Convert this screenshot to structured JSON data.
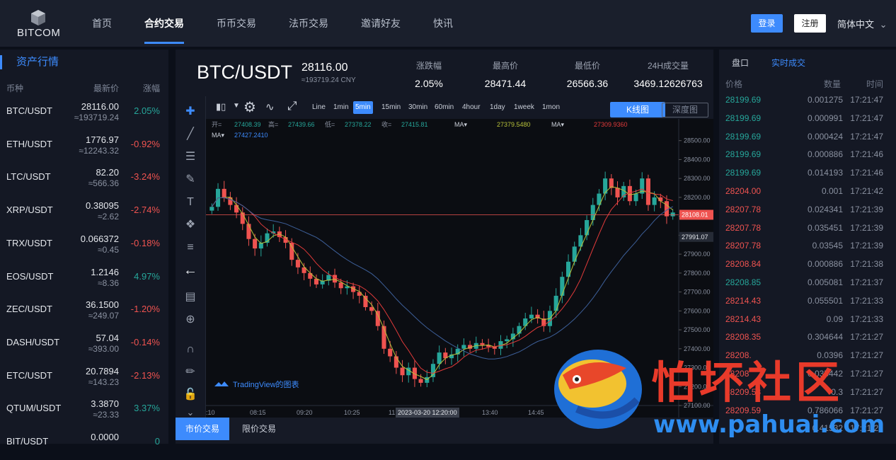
{
  "brand": {
    "name": "BITCOM"
  },
  "nav": {
    "items": [
      "首页",
      "合约交易",
      "币币交易",
      "法币交易",
      "邀请好友",
      "快讯"
    ],
    "active": 1
  },
  "auth": {
    "login": "登录",
    "register": "注册",
    "language": "简体中文"
  },
  "market": {
    "title": "资产行情",
    "headers": {
      "symbol": "币种",
      "price": "最新价",
      "change": "涨幅"
    },
    "rows": [
      {
        "symbol": "BTC/USDT",
        "price": "28116.00",
        "cny": "≈193719.24",
        "change": "2.05%",
        "dir": "up"
      },
      {
        "symbol": "ETH/USDT",
        "price": "1776.97",
        "cny": "≈12243.32",
        "change": "-0.92%",
        "dir": "dn"
      },
      {
        "symbol": "LTC/USDT",
        "price": "82.20",
        "cny": "≈566.36",
        "change": "-3.24%",
        "dir": "dn"
      },
      {
        "symbol": "XRP/USDT",
        "price": "0.38095",
        "cny": "≈2.62",
        "change": "-2.74%",
        "dir": "dn"
      },
      {
        "symbol": "TRX/USDT",
        "price": "0.066372",
        "cny": "≈0.45",
        "change": "-0.18%",
        "dir": "dn"
      },
      {
        "symbol": "EOS/USDT",
        "price": "1.2146",
        "cny": "≈8.36",
        "change": "4.97%",
        "dir": "up"
      },
      {
        "symbol": "ZEC/USDT",
        "price": "36.1500",
        "cny": "≈249.07",
        "change": "-1.20%",
        "dir": "dn"
      },
      {
        "symbol": "DASH/USDT",
        "price": "57.04",
        "cny": "≈393.00",
        "change": "-0.14%",
        "dir": "dn"
      },
      {
        "symbol": "ETC/USDT",
        "price": "20.7894",
        "cny": "≈143.23",
        "change": "-2.13%",
        "dir": "dn"
      },
      {
        "symbol": "QTUM/USDT",
        "price": "3.3870",
        "cny": "≈23.33",
        "change": "3.37%",
        "dir": "up"
      },
      {
        "symbol": "BIT/USDT",
        "price": "0.0000",
        "cny": "",
        "change": "0",
        "dir": "up"
      }
    ]
  },
  "ticker": {
    "symbol": "BTC/USDT",
    "price": "28116.00",
    "cny": "≈193719.24 CNY",
    "stats": [
      {
        "label": "涨跌幅",
        "value": "2.05%"
      },
      {
        "label": "最高价",
        "value": "28471.44"
      },
      {
        "label": "最低价",
        "value": "26566.36"
      },
      {
        "label": "24H成交量",
        "value": "3469.12626763"
      }
    ]
  },
  "toolbar": {
    "timeframes": [
      "Line",
      "1min",
      "5min",
      "15min",
      "30min",
      "60min",
      "4hour",
      "1day",
      "1week",
      "1mon"
    ],
    "active": "5min",
    "kline": "K线图",
    "depth": "深度图"
  },
  "chart_data": {
    "type": "candlestick",
    "ohlc_legend": {
      "open_label": "开=",
      "open": "27408.39",
      "high_label": "高=",
      "high": "27439.66",
      "low_label": "低=",
      "low": "27378.22",
      "close_label": "收=",
      "close": "27415.81"
    },
    "ma_labels": [
      {
        "label": "MA▾",
        "value": "27427.2410"
      },
      {
        "label": "MA▾",
        "value": "27379.5480"
      },
      {
        "label": "MA▾",
        "value": "27309.9360"
      }
    ],
    "y_ticks": [
      "28500.00",
      "28400.00",
      "28300.00",
      "28200.00",
      "28100.00",
      "28000.00",
      "27900.00",
      "27800.00",
      "27700.00",
      "27600.00",
      "27500.00",
      "27400.00",
      "27300.00",
      "27200.00",
      "27100.00"
    ],
    "ylim": [
      27100,
      28540
    ],
    "x_ticks": [
      ":10",
      "08:15",
      "09:20",
      "10:25",
      "11:",
      "13:40",
      "14:45"
    ],
    "crosshair_time": "2023-03-20 12:20:00",
    "last_price_label": "28108.01",
    "line_price_label": "27991.07",
    "last_price": 28108.01,
    "line_price": 27991.07,
    "close": [
      28150,
      28245,
      28200,
      28160,
      28120,
      28060,
      27980,
      27930,
      27960,
      28010,
      28020,
      27990,
      27960,
      27870,
      27830,
      27800,
      27770,
      27740,
      27760,
      27790,
      27750,
      27720,
      27730,
      27700,
      27680,
      27620,
      27600,
      27520,
      27400,
      27360,
      27300,
      27260,
      27300,
      27240,
      27220,
      27250,
      27320,
      27380,
      27350,
      27370,
      27400,
      27420,
      27400,
      27430,
      27420,
      27410,
      27400,
      27440,
      27450,
      27480,
      27520,
      27560,
      27580,
      27560,
      27520,
      27600,
      27680,
      27780,
      27860,
      27940,
      28000,
      28080,
      28160,
      28220,
      28300,
      28250,
      28200,
      28260,
      28180,
      28220,
      28300,
      28160,
      28200,
      28180,
      28100,
      28120
    ],
    "watermark": "TradingView的图表"
  },
  "bottom": {
    "tabs": [
      "市价交易",
      "限价交易"
    ]
  },
  "trades": {
    "tabs": [
      "盘口",
      "实时成交"
    ],
    "headers": {
      "price": "价格",
      "amount": "数量",
      "time": "时间"
    },
    "rows": [
      {
        "price": "28199.69",
        "amount": "0.001275",
        "time": "17:21:47",
        "dir": "up"
      },
      {
        "price": "28199.69",
        "amount": "0.000991",
        "time": "17:21:47",
        "dir": "up"
      },
      {
        "price": "28199.69",
        "amount": "0.000424",
        "time": "17:21:47",
        "dir": "up"
      },
      {
        "price": "28199.69",
        "amount": "0.000886",
        "time": "17:21:46",
        "dir": "up"
      },
      {
        "price": "28199.69",
        "amount": "0.014193",
        "time": "17:21:46",
        "dir": "up"
      },
      {
        "price": "28204.00",
        "amount": "0.001",
        "time": "17:21:42",
        "dir": "dn"
      },
      {
        "price": "28207.78",
        "amount": "0.024341",
        "time": "17:21:39",
        "dir": "dn"
      },
      {
        "price": "28207.78",
        "amount": "0.035451",
        "time": "17:21:39",
        "dir": "dn"
      },
      {
        "price": "28207.78",
        "amount": "0.03545",
        "time": "17:21:39",
        "dir": "dn"
      },
      {
        "price": "28208.84",
        "amount": "0.000886",
        "time": "17:21:38",
        "dir": "dn"
      },
      {
        "price": "28208.85",
        "amount": "0.005081",
        "time": "17:21:37",
        "dir": "up"
      },
      {
        "price": "28214.43",
        "amount": "0.055501",
        "time": "17:21:33",
        "dir": "dn"
      },
      {
        "price": "28214.43",
        "amount": "0.09",
        "time": "17:21:33",
        "dir": "dn"
      },
      {
        "price": "28208.35",
        "amount": "0.304644",
        "time": "17:21:27",
        "dir": "dn"
      },
      {
        "price": "28208.",
        "amount": "0.0396",
        "time": "17:21:27",
        "dir": "dn"
      },
      {
        "price": "28208",
        "amount": "0.035442",
        "time": "17:21:27",
        "dir": "dn"
      },
      {
        "price": "28209.58",
        "amount": "0.3",
        "time": "17:21:27",
        "dir": "dn"
      },
      {
        "price": "28209.59",
        "amount": "0.786066",
        "time": "17:21:27",
        "dir": "dn"
      },
      {
        "price": "",
        "amount": "0.41532",
        "time": "17:21:27",
        "dir": "dn"
      }
    ]
  },
  "watermark": {
    "title": "怕坏社区",
    "url": "www.pahuai.com"
  }
}
